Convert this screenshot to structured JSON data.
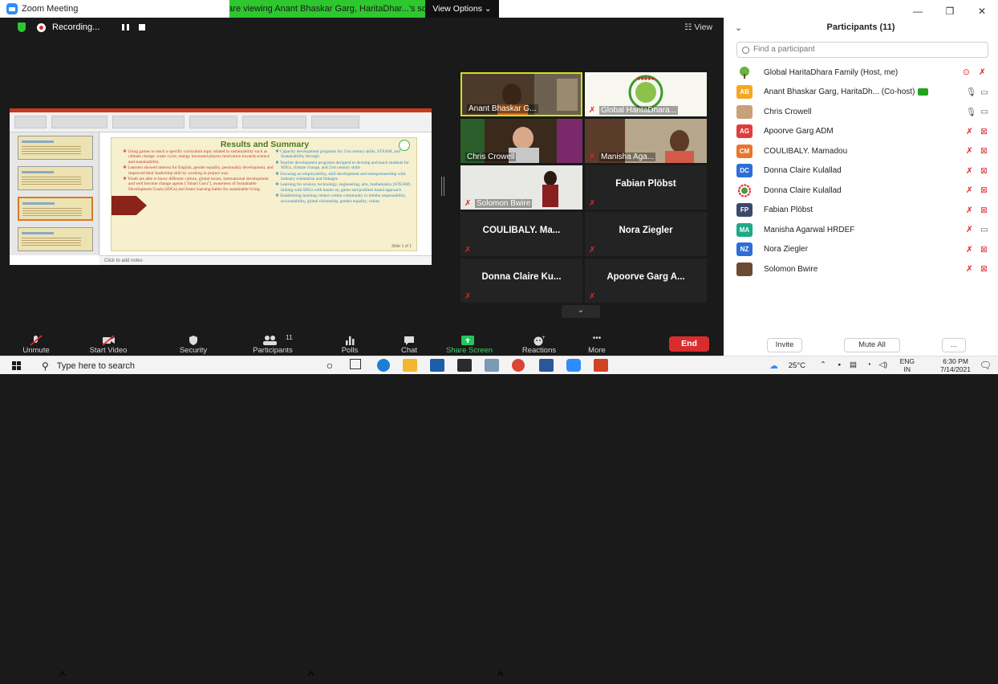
{
  "window": {
    "title": "Zoom Meeting"
  },
  "banner": {
    "message": "You are viewing Anant Bhaskar Garg, HaritaDhar...'s screen",
    "view_options": "View Options ⌄"
  },
  "recording": {
    "label": "Recording..."
  },
  "view_button": "View",
  "slide": {
    "title": "Results and Summary",
    "left_bullets": [
      "Using games to teach a specific curriculum topic related to sustainability such as climate change, water cycle, energy increased players motivation towards science and sustainability.",
      "Learners showed interest for English, gender equality, personality development, and improved their leadership skill by working in project way.",
      "Youth are able to know different culture, global issues, international development and well become change agents (\"Smart Guru\"), awareness of Sustainable Development Goals (SDGs) and foster learning habits for sustainable living."
    ],
    "right_bullets": [
      "Capacity development programs for 21st century skills, STEAM, and Sustainability through",
      "Teacher development programs designed to develop and teach students for SDGs, climate change, and 21st century skills",
      "Focusing on employability, skill development and entrepreneurship with industry orientation and linkages",
      "Learning for science, technology, engineering, arts, mathematics (STEAM) linking with SDGs with hands-on, game and problem based approach",
      "Establishing learning centers within community to imbibe responsibility, accountability, global citizenship, gender equality, values"
    ],
    "notes": "Click to add notes",
    "pager": "Slide 1 of 1"
  },
  "gallery": [
    {
      "name": "Anant Bhaskar G...",
      "muted": false,
      "video": true
    },
    {
      "name": "Global HaritaDhara...",
      "muted": true,
      "video": true
    },
    {
      "name": "Chris Crowell",
      "muted": false,
      "video": true
    },
    {
      "name": "Manisha Aga...",
      "muted": true,
      "video": true
    },
    {
      "name": "Solomon Bwire",
      "muted": true,
      "video": true
    },
    {
      "name": "Fabian Plöbst",
      "muted": true,
      "video": false
    },
    {
      "name": "COULIBALY. Ma...",
      "muted": true,
      "video": false
    },
    {
      "name": "Nora Ziegler",
      "muted": true,
      "video": false
    },
    {
      "name": "Donna Claire Ku...",
      "muted": true,
      "video": false
    },
    {
      "name": "Apoorve Garg A...",
      "muted": true,
      "video": false
    }
  ],
  "gallery_more": "⌄",
  "toolbar": {
    "unmute": "Unmute",
    "start_video": "Start Video",
    "security": "Security",
    "participants": "Participants",
    "participants_count": "11",
    "polls": "Polls",
    "chat": "Chat",
    "share_screen": "Share Screen",
    "reactions": "Reactions",
    "more": "More",
    "end": "End"
  },
  "panel": {
    "title": "Participants (11)",
    "search_placeholder": "Find a participant",
    "participants": [
      {
        "name": "Global HaritaDhara Family (Host, me)",
        "initials": "",
        "color": "#ffffff",
        "mic": "muted",
        "video": "on"
      },
      {
        "name": "Anant Bhaskar Garg, HaritaDh... (Co-host)",
        "initials": "AB",
        "color": "#f5a623",
        "mic": "on",
        "video": "on"
      },
      {
        "name": "Chris Crowell",
        "initials": "",
        "color": "#caa07a",
        "mic": "on",
        "video": "on"
      },
      {
        "name": "Apoorve Garg ADM",
        "initials": "AG",
        "color": "#e03c3c",
        "mic": "muted",
        "video": "off"
      },
      {
        "name": "COULIBALY. Mamadou",
        "initials": "CM",
        "color": "#e8762d",
        "mic": "muted",
        "video": "off"
      },
      {
        "name": "Donna Claire Kulallad",
        "initials": "DC",
        "color": "#2d6fd6",
        "mic": "muted",
        "video": "off"
      },
      {
        "name": "Donna Claire Kulallad",
        "initials": "",
        "color": "#4a4a4a",
        "mic": "muted",
        "video": "off"
      },
      {
        "name": "Fabian Plöbst",
        "initials": "FP",
        "color": "#3b4a6b",
        "mic": "muted",
        "video": "off"
      },
      {
        "name": "Manisha Agarwal HRDEF",
        "initials": "MA",
        "color": "#1fa88a",
        "mic": "muted",
        "video": "on"
      },
      {
        "name": "Nora Ziegler",
        "initials": "NZ",
        "color": "#2d6fd6",
        "mic": "muted",
        "video": "off"
      },
      {
        "name": "Solomon Bwire",
        "initials": "",
        "color": "#6b4a32",
        "mic": "muted",
        "video": "off"
      }
    ],
    "invite": "Invite",
    "mute_all": "Mute All",
    "more": "..."
  },
  "taskbar": {
    "search_placeholder": "Type here to search",
    "weather": "25°C",
    "lang": "ENG",
    "region": "IN",
    "time": "6:30 PM",
    "date": "7/14/2021"
  }
}
